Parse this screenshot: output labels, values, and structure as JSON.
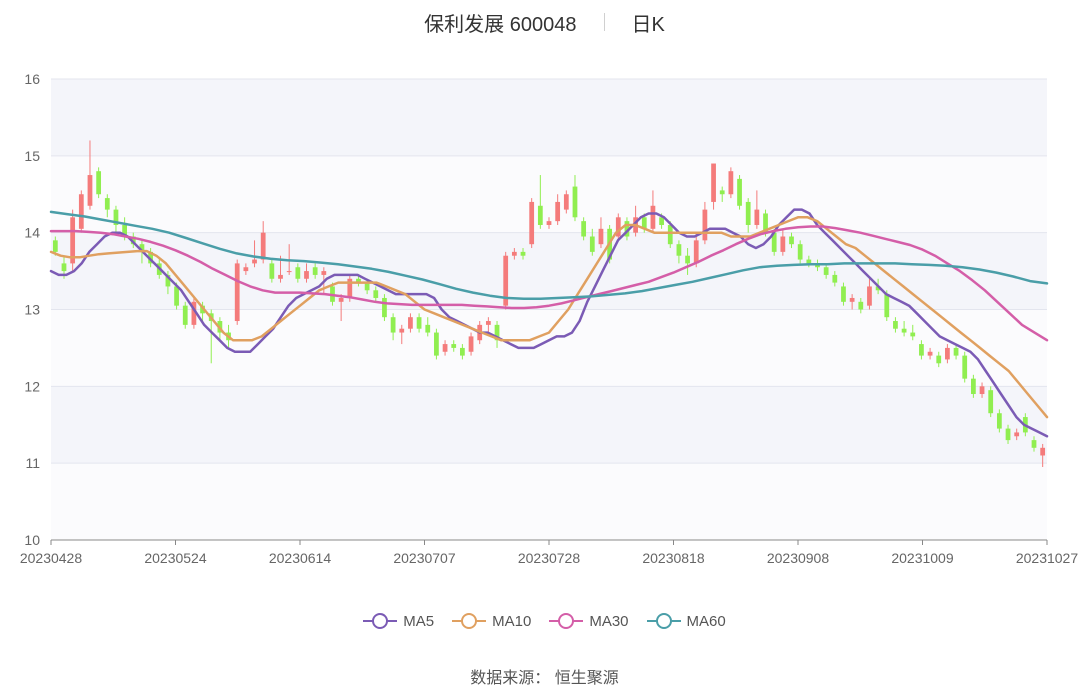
{
  "header": {
    "title": "保利发展 600048",
    "period": "日K"
  },
  "source": "数据来源：  恒生聚源",
  "colors": {
    "up": "#f47b7b",
    "down": "#90ee50",
    "MA5": "#7b5bb5",
    "MA10": "#e0a060",
    "MA30": "#d45ea8",
    "MA60": "#4a9ea8"
  },
  "chart_data": {
    "type": "candlestick",
    "title": "保利发展 600048 日K",
    "y_ticks": [
      "10",
      "11",
      "12",
      "13",
      "14",
      "15",
      "16"
    ],
    "ylim": [
      10,
      16
    ],
    "x_ticks": [
      "20230428",
      "20230524",
      "20230614",
      "20230707",
      "20230728",
      "20230818",
      "20230908",
      "20231009",
      "20231027"
    ],
    "grid": "horizontal",
    "legend_position": "bottom-center",
    "candles": [
      [
        13.9,
        13.75,
        13.95,
        13.7
      ],
      [
        13.6,
        13.5,
        13.7,
        13.4
      ],
      [
        13.6,
        14.2,
        14.3,
        13.5
      ],
      [
        14.05,
        14.5,
        14.55,
        14.0
      ],
      [
        14.35,
        14.75,
        15.2,
        14.3
      ],
      [
        14.8,
        14.5,
        14.85,
        14.45
      ],
      [
        14.45,
        14.3,
        14.5,
        14.2
      ],
      [
        14.3,
        14.1,
        14.35,
        14.0
      ],
      [
        14.1,
        13.95,
        14.2,
        13.9
      ],
      [
        13.95,
        13.85,
        14.0,
        13.8
      ],
      [
        13.85,
        13.75,
        13.9,
        13.6
      ],
      [
        13.75,
        13.6,
        13.8,
        13.55
      ],
      [
        13.6,
        13.45,
        13.65,
        13.4
      ],
      [
        13.45,
        13.3,
        13.5,
        13.2
      ],
      [
        13.3,
        13.05,
        13.35,
        13.0
      ],
      [
        13.05,
        12.8,
        13.1,
        12.75
      ],
      [
        12.8,
        13.1,
        13.15,
        12.75
      ],
      [
        13.05,
        12.95,
        13.1,
        12.85
      ],
      [
        12.95,
        12.85,
        13.0,
        12.3
      ],
      [
        12.85,
        12.7,
        12.9,
        12.6
      ],
      [
        12.7,
        12.6,
        12.8,
        12.5
      ],
      [
        12.85,
        13.6,
        13.65,
        12.8
      ],
      [
        13.5,
        13.55,
        13.6,
        13.45
      ],
      [
        13.6,
        13.65,
        13.9,
        13.55
      ],
      [
        13.65,
        14.0,
        14.15,
        13.6
      ],
      [
        13.6,
        13.4,
        13.65,
        13.35
      ],
      [
        13.4,
        13.45,
        13.7,
        13.35
      ],
      [
        13.5,
        13.5,
        13.85,
        13.45
      ],
      [
        13.55,
        13.4,
        13.6,
        13.35
      ],
      [
        13.4,
        13.5,
        13.6,
        13.35
      ],
      [
        13.55,
        13.45,
        13.6,
        13.4
      ],
      [
        13.45,
        13.5,
        13.55,
        13.2
      ],
      [
        13.3,
        13.1,
        13.35,
        13.05
      ],
      [
        13.1,
        13.15,
        13.2,
        12.85
      ],
      [
        13.15,
        13.4,
        13.45,
        13.1
      ],
      [
        13.4,
        13.35,
        13.45,
        13.3
      ],
      [
        13.35,
        13.25,
        13.4,
        13.2
      ],
      [
        13.25,
        13.15,
        13.3,
        13.1
      ],
      [
        13.15,
        12.9,
        13.2,
        12.85
      ],
      [
        12.9,
        12.7,
        12.95,
        12.6
      ],
      [
        12.7,
        12.75,
        12.8,
        12.55
      ],
      [
        12.75,
        12.9,
        12.95,
        12.7
      ],
      [
        12.9,
        12.75,
        12.95,
        12.7
      ],
      [
        12.8,
        12.7,
        12.9,
        12.65
      ],
      [
        12.7,
        12.4,
        12.75,
        12.35
      ],
      [
        12.45,
        12.55,
        12.6,
        12.4
      ],
      [
        12.55,
        12.5,
        12.6,
        12.45
      ],
      [
        12.5,
        12.4,
        12.55,
        12.35
      ],
      [
        12.45,
        12.65,
        12.7,
        12.4
      ],
      [
        12.6,
        12.8,
        12.85,
        12.55
      ],
      [
        12.8,
        12.85,
        12.9,
        12.7
      ],
      [
        12.8,
        12.6,
        12.85,
        12.5
      ],
      [
        13.05,
        13.7,
        13.75,
        13.0
      ],
      [
        13.7,
        13.75,
        13.8,
        13.65
      ],
      [
        13.75,
        13.7,
        13.8,
        13.65
      ],
      [
        13.85,
        14.4,
        14.45,
        13.8
      ],
      [
        14.35,
        14.1,
        14.75,
        14.05
      ],
      [
        14.1,
        14.15,
        14.2,
        14.05
      ],
      [
        14.15,
        14.4,
        14.5,
        14.1
      ],
      [
        14.3,
        14.5,
        14.55,
        14.25
      ],
      [
        14.6,
        14.2,
        14.75,
        14.15
      ],
      [
        14.15,
        13.95,
        14.2,
        13.9
      ],
      [
        13.95,
        13.75,
        14.05,
        13.7
      ],
      [
        13.85,
        14.05,
        14.2,
        13.8
      ],
      [
        14.05,
        13.65,
        14.1,
        13.6
      ],
      [
        13.95,
        14.2,
        14.25,
        13.9
      ],
      [
        14.15,
        13.95,
        14.2,
        13.9
      ],
      [
        14.0,
        14.2,
        14.35,
        13.95
      ],
      [
        14.2,
        14.05,
        14.25,
        14.0
      ],
      [
        14.05,
        14.35,
        14.55,
        14.0
      ],
      [
        14.2,
        14.1,
        14.25,
        14.05
      ],
      [
        14.1,
        13.85,
        14.15,
        13.8
      ],
      [
        13.85,
        13.7,
        13.9,
        13.6
      ],
      [
        13.7,
        13.6,
        13.8,
        13.45
      ],
      [
        13.6,
        13.9,
        14.0,
        13.55
      ],
      [
        13.9,
        14.3,
        14.4,
        13.85
      ],
      [
        14.4,
        14.9,
        14.9,
        14.3
      ],
      [
        14.55,
        14.5,
        14.6,
        14.4
      ],
      [
        14.5,
        14.8,
        14.85,
        14.45
      ],
      [
        14.7,
        14.35,
        14.75,
        14.3
      ],
      [
        14.4,
        14.1,
        14.45,
        14.0
      ],
      [
        14.1,
        14.3,
        14.55,
        14.05
      ],
      [
        14.25,
        14.0,
        14.3,
        13.95
      ],
      [
        14.0,
        13.75,
        14.05,
        13.7
      ],
      [
        13.75,
        13.95,
        14.05,
        13.7
      ],
      [
        13.95,
        13.85,
        14.0,
        13.8
      ],
      [
        13.85,
        13.65,
        13.9,
        13.6
      ],
      [
        13.65,
        13.6,
        13.7,
        13.55
      ],
      [
        13.6,
        13.55,
        13.65,
        13.5
      ],
      [
        13.55,
        13.45,
        13.6,
        13.4
      ],
      [
        13.45,
        13.35,
        13.5,
        13.3
      ],
      [
        13.3,
        13.1,
        13.35,
        13.05
      ],
      [
        13.1,
        13.15,
        13.2,
        13.0
      ],
      [
        13.1,
        13.0,
        13.15,
        12.95
      ],
      [
        13.05,
        13.3,
        13.4,
        13.0
      ],
      [
        13.3,
        13.25,
        13.4,
        13.2
      ],
      [
        13.2,
        12.9,
        13.25,
        12.85
      ],
      [
        12.85,
        12.75,
        12.9,
        12.7
      ],
      [
        12.75,
        12.7,
        12.85,
        12.65
      ],
      [
        12.7,
        12.65,
        12.8,
        12.6
      ],
      [
        12.55,
        12.4,
        12.6,
        12.35
      ],
      [
        12.4,
        12.45,
        12.5,
        12.35
      ],
      [
        12.4,
        12.3,
        12.45,
        12.25
      ],
      [
        12.35,
        12.5,
        12.55,
        12.3
      ],
      [
        12.5,
        12.4,
        12.55,
        12.35
      ],
      [
        12.4,
        12.1,
        12.45,
        12.05
      ],
      [
        12.1,
        11.9,
        12.15,
        11.85
      ],
      [
        11.9,
        12.0,
        12.05,
        11.85
      ],
      [
        11.95,
        11.65,
        12.0,
        11.6
      ],
      [
        11.65,
        11.45,
        11.7,
        11.4
      ],
      [
        11.45,
        11.3,
        11.5,
        11.25
      ],
      [
        11.35,
        11.4,
        11.45,
        11.3
      ],
      [
        11.6,
        11.4,
        11.65,
        11.35
      ],
      [
        11.3,
        11.2,
        11.35,
        11.15
      ],
      [
        11.1,
        11.2,
        11.25,
        10.95
      ]
    ],
    "series": [
      {
        "name": "MA5",
        "values": [
          13.5,
          13.45,
          13.45,
          13.5,
          13.6,
          13.75,
          13.85,
          13.95,
          14.0,
          14.0,
          13.95,
          13.85,
          13.75,
          13.65,
          13.55,
          13.45,
          13.35,
          13.25,
          13.1,
          12.95,
          12.8,
          12.7,
          12.6,
          12.5,
          12.45,
          12.45,
          12.45,
          12.55,
          12.65,
          12.75,
          12.9,
          13.05,
          13.15,
          13.2,
          13.25,
          13.3,
          13.4,
          13.45,
          13.45,
          13.45,
          13.45,
          13.4,
          13.35,
          13.3,
          13.25,
          13.2,
          13.2,
          13.2,
          13.2,
          13.2,
          13.15,
          13.0,
          12.9,
          12.85,
          12.8,
          12.75,
          12.7,
          12.7,
          12.65,
          12.6,
          12.55,
          12.5,
          12.5,
          12.5,
          12.55,
          12.6,
          12.65,
          12.65,
          12.7,
          12.85,
          13.1,
          13.3,
          13.5,
          13.7,
          13.9,
          14.0,
          14.1,
          14.2,
          14.25,
          14.25,
          14.2,
          14.1,
          14.0,
          13.95,
          13.95,
          14.0,
          14.05,
          14.05,
          14.05,
          14.0,
          13.95,
          13.85,
          13.8,
          13.85,
          13.95,
          14.1,
          14.2,
          14.3,
          14.3,
          14.25,
          14.1,
          14.0,
          13.9,
          13.8,
          13.7,
          13.6,
          13.5,
          13.4,
          13.3,
          13.2,
          13.15,
          13.1,
          13.05,
          12.95,
          12.85,
          12.75,
          12.65,
          12.6,
          12.55,
          12.5,
          12.45,
          12.35,
          12.2,
          12.05,
          11.9,
          11.75,
          11.6,
          11.5,
          11.45,
          11.4,
          11.35
        ]
      },
      {
        "name": "MA10",
        "values": [
          13.75,
          13.7,
          13.68,
          13.68,
          13.7,
          13.72,
          13.73,
          13.74,
          13.75,
          13.76,
          13.76,
          13.7,
          13.6,
          13.45,
          13.3,
          13.15,
          13.0,
          12.85,
          12.7,
          12.6,
          12.6,
          12.6,
          12.65,
          12.75,
          12.85,
          12.95,
          13.05,
          13.15,
          13.25,
          13.3,
          13.35,
          13.35,
          13.35,
          13.35,
          13.35,
          13.3,
          13.25,
          13.2,
          13.1,
          13.0,
          12.95,
          12.9,
          12.85,
          12.8,
          12.75,
          12.7,
          12.65,
          12.6,
          12.6,
          12.6,
          12.6,
          12.65,
          12.7,
          12.85,
          13.0,
          13.2,
          13.4,
          13.6,
          13.8,
          14.0,
          14.1,
          14.1,
          14.05,
          14.0,
          14.0,
          14.0,
          14.0,
          14.0,
          14.0,
          14.0,
          14.0,
          13.95,
          13.95,
          13.95,
          14.0,
          14.05,
          14.1,
          14.15,
          14.2,
          14.2,
          14.15,
          14.05,
          13.95,
          13.85,
          13.8,
          13.7,
          13.6,
          13.5,
          13.4,
          13.3,
          13.2,
          13.1,
          13.0,
          12.9,
          12.8,
          12.7,
          12.6,
          12.5,
          12.4,
          12.3,
          12.2,
          12.05,
          11.9,
          11.75,
          11.6
        ]
      },
      {
        "name": "MA30",
        "values": [
          14.02,
          14.02,
          14.02,
          14.01,
          14.0,
          13.98,
          13.95,
          13.92,
          13.88,
          13.83,
          13.77,
          13.7,
          13.62,
          13.53,
          13.45,
          13.37,
          13.3,
          13.25,
          13.22,
          13.22,
          13.22,
          13.21,
          13.2,
          13.18,
          13.16,
          13.13,
          13.1,
          13.08,
          13.07,
          13.06,
          13.06,
          13.06,
          13.06,
          13.06,
          13.05,
          13.04,
          13.03,
          13.02,
          13.02,
          13.03,
          13.05,
          13.08,
          13.12,
          13.16,
          13.2,
          13.24,
          13.28,
          13.32,
          13.36,
          13.42,
          13.48,
          13.55,
          13.62,
          13.7,
          13.77,
          13.85,
          13.92,
          13.98,
          14.02,
          14.05,
          14.07,
          14.08,
          14.08,
          14.06,
          14.03,
          14.0,
          13.96,
          13.92,
          13.88,
          13.84,
          13.78,
          13.7,
          13.6,
          13.5,
          13.38,
          13.25,
          13.1,
          12.95,
          12.8,
          12.7,
          12.6
        ]
      },
      {
        "name": "MA60",
        "values": [
          14.27,
          14.24,
          14.21,
          14.17,
          14.13,
          14.09,
          14.05,
          14.0,
          13.93,
          13.86,
          13.79,
          13.73,
          13.69,
          13.66,
          13.64,
          13.63,
          13.61,
          13.59,
          13.56,
          13.53,
          13.49,
          13.44,
          13.39,
          13.33,
          13.27,
          13.22,
          13.18,
          13.15,
          13.14,
          13.14,
          13.15,
          13.16,
          13.17,
          13.19,
          13.21,
          13.24,
          13.28,
          13.32,
          13.36,
          13.41,
          13.46,
          13.51,
          13.55,
          13.57,
          13.58,
          13.59,
          13.59,
          13.6,
          13.6,
          13.6,
          13.6,
          13.59,
          13.58,
          13.57,
          13.55,
          13.52,
          13.48,
          13.43,
          13.37,
          13.34
        ]
      }
    ]
  }
}
